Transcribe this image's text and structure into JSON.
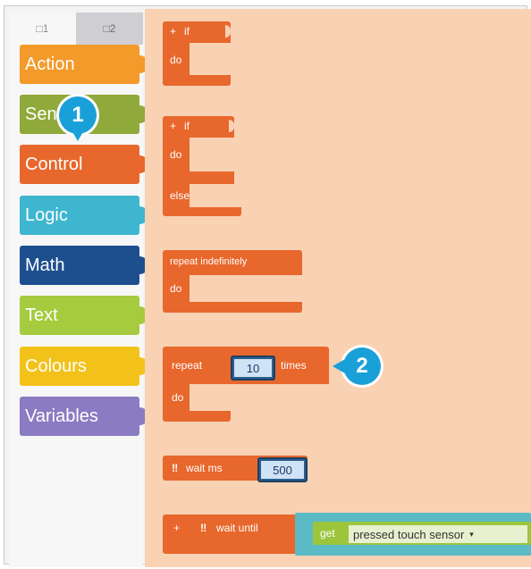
{
  "tabs": [
    {
      "label": "□1"
    },
    {
      "label": "□2"
    }
  ],
  "categories": [
    {
      "label": "Action",
      "color": "#f39a2a"
    },
    {
      "label": "Sen",
      "color": "#8fa93a"
    },
    {
      "label": "Control",
      "color": "#e8672c"
    },
    {
      "label": "Logic",
      "color": "#3fb6cf"
    },
    {
      "label": "Math",
      "color": "#1d4f8f"
    },
    {
      "label": "Text",
      "color": "#a6cb3e"
    },
    {
      "label": "Colours",
      "color": "#f2c21b"
    },
    {
      "label": "Variables",
      "color": "#8a7bc2"
    }
  ],
  "callouts": {
    "one": "1",
    "two": "2"
  },
  "blocks": {
    "if_do": {
      "plus": "+",
      "if": "if",
      "do": "do"
    },
    "if_else": {
      "plus": "+",
      "if": "if",
      "do": "do",
      "else": "else"
    },
    "repeat_forever": {
      "label": "repeat indefinitely",
      "do": "do"
    },
    "repeat_times": {
      "repeat": "repeat",
      "count": "10",
      "times": "times",
      "do": "do"
    },
    "wait_ms": {
      "icon": "‼",
      "label": "wait ms",
      "value": "500"
    },
    "wait_until": {
      "plus": "+",
      "icon": "‼",
      "label": "wait until",
      "get": "get",
      "sensor": "pressed touch sensor"
    }
  },
  "colors": {
    "control": "#e8672c",
    "workspace": "#f9d1b3",
    "callout": "#1aa0d8"
  }
}
